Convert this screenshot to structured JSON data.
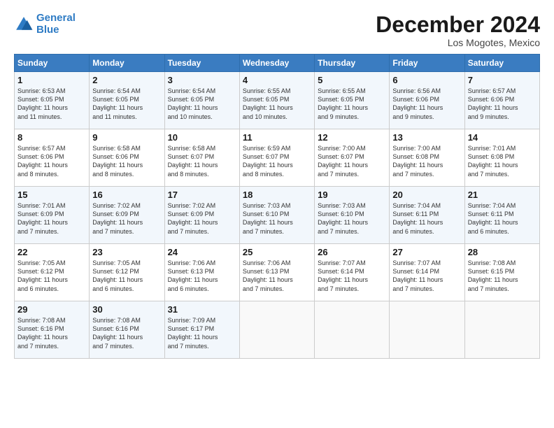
{
  "logo": {
    "line1": "General",
    "line2": "Blue"
  },
  "title": "December 2024",
  "subtitle": "Los Mogotes, Mexico",
  "days_of_week": [
    "Sunday",
    "Monday",
    "Tuesday",
    "Wednesday",
    "Thursday",
    "Friday",
    "Saturday"
  ],
  "weeks": [
    [
      {
        "day": "1",
        "info": "Sunrise: 6:53 AM\nSunset: 6:05 PM\nDaylight: 11 hours\nand 11 minutes."
      },
      {
        "day": "2",
        "info": "Sunrise: 6:54 AM\nSunset: 6:05 PM\nDaylight: 11 hours\nand 11 minutes."
      },
      {
        "day": "3",
        "info": "Sunrise: 6:54 AM\nSunset: 6:05 PM\nDaylight: 11 hours\nand 10 minutes."
      },
      {
        "day": "4",
        "info": "Sunrise: 6:55 AM\nSunset: 6:05 PM\nDaylight: 11 hours\nand 10 minutes."
      },
      {
        "day": "5",
        "info": "Sunrise: 6:55 AM\nSunset: 6:05 PM\nDaylight: 11 hours\nand 9 minutes."
      },
      {
        "day": "6",
        "info": "Sunrise: 6:56 AM\nSunset: 6:06 PM\nDaylight: 11 hours\nand 9 minutes."
      },
      {
        "day": "7",
        "info": "Sunrise: 6:57 AM\nSunset: 6:06 PM\nDaylight: 11 hours\nand 9 minutes."
      }
    ],
    [
      {
        "day": "8",
        "info": "Sunrise: 6:57 AM\nSunset: 6:06 PM\nDaylight: 11 hours\nand 8 minutes."
      },
      {
        "day": "9",
        "info": "Sunrise: 6:58 AM\nSunset: 6:06 PM\nDaylight: 11 hours\nand 8 minutes."
      },
      {
        "day": "10",
        "info": "Sunrise: 6:58 AM\nSunset: 6:07 PM\nDaylight: 11 hours\nand 8 minutes."
      },
      {
        "day": "11",
        "info": "Sunrise: 6:59 AM\nSunset: 6:07 PM\nDaylight: 11 hours\nand 8 minutes."
      },
      {
        "day": "12",
        "info": "Sunrise: 7:00 AM\nSunset: 6:07 PM\nDaylight: 11 hours\nand 7 minutes."
      },
      {
        "day": "13",
        "info": "Sunrise: 7:00 AM\nSunset: 6:08 PM\nDaylight: 11 hours\nand 7 minutes."
      },
      {
        "day": "14",
        "info": "Sunrise: 7:01 AM\nSunset: 6:08 PM\nDaylight: 11 hours\nand 7 minutes."
      }
    ],
    [
      {
        "day": "15",
        "info": "Sunrise: 7:01 AM\nSunset: 6:09 PM\nDaylight: 11 hours\nand 7 minutes."
      },
      {
        "day": "16",
        "info": "Sunrise: 7:02 AM\nSunset: 6:09 PM\nDaylight: 11 hours\nand 7 minutes."
      },
      {
        "day": "17",
        "info": "Sunrise: 7:02 AM\nSunset: 6:09 PM\nDaylight: 11 hours\nand 7 minutes."
      },
      {
        "day": "18",
        "info": "Sunrise: 7:03 AM\nSunset: 6:10 PM\nDaylight: 11 hours\nand 7 minutes."
      },
      {
        "day": "19",
        "info": "Sunrise: 7:03 AM\nSunset: 6:10 PM\nDaylight: 11 hours\nand 7 minutes."
      },
      {
        "day": "20",
        "info": "Sunrise: 7:04 AM\nSunset: 6:11 PM\nDaylight: 11 hours\nand 6 minutes."
      },
      {
        "day": "21",
        "info": "Sunrise: 7:04 AM\nSunset: 6:11 PM\nDaylight: 11 hours\nand 6 minutes."
      }
    ],
    [
      {
        "day": "22",
        "info": "Sunrise: 7:05 AM\nSunset: 6:12 PM\nDaylight: 11 hours\nand 6 minutes."
      },
      {
        "day": "23",
        "info": "Sunrise: 7:05 AM\nSunset: 6:12 PM\nDaylight: 11 hours\nand 6 minutes."
      },
      {
        "day": "24",
        "info": "Sunrise: 7:06 AM\nSunset: 6:13 PM\nDaylight: 11 hours\nand 6 minutes."
      },
      {
        "day": "25",
        "info": "Sunrise: 7:06 AM\nSunset: 6:13 PM\nDaylight: 11 hours\nand 7 minutes."
      },
      {
        "day": "26",
        "info": "Sunrise: 7:07 AM\nSunset: 6:14 PM\nDaylight: 11 hours\nand 7 minutes."
      },
      {
        "day": "27",
        "info": "Sunrise: 7:07 AM\nSunset: 6:14 PM\nDaylight: 11 hours\nand 7 minutes."
      },
      {
        "day": "28",
        "info": "Sunrise: 7:08 AM\nSunset: 6:15 PM\nDaylight: 11 hours\nand 7 minutes."
      }
    ],
    [
      {
        "day": "29",
        "info": "Sunrise: 7:08 AM\nSunset: 6:16 PM\nDaylight: 11 hours\nand 7 minutes."
      },
      {
        "day": "30",
        "info": "Sunrise: 7:08 AM\nSunset: 6:16 PM\nDaylight: 11 hours\nand 7 minutes."
      },
      {
        "day": "31",
        "info": "Sunrise: 7:09 AM\nSunset: 6:17 PM\nDaylight: 11 hours\nand 7 minutes."
      },
      {
        "day": "",
        "info": ""
      },
      {
        "day": "",
        "info": ""
      },
      {
        "day": "",
        "info": ""
      },
      {
        "day": "",
        "info": ""
      }
    ]
  ]
}
